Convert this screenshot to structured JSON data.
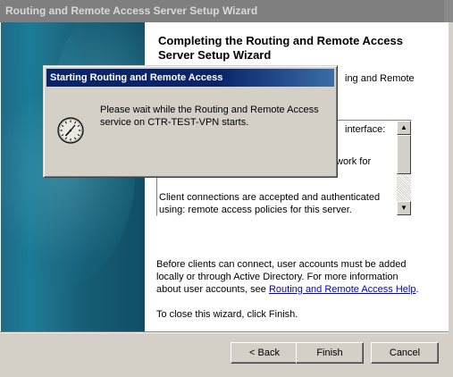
{
  "wizard": {
    "title": "Routing and Remote Access Server Setup Wizard",
    "heading": "Completing the Routing and Remote Access Server Setup Wizard",
    "intro_visible": "ing and Remote",
    "summary_lines": [
      "interface:",
      "work for",
      "Client connections are accepted and authenticated",
      "using: remote access policies for this server."
    ],
    "para1_text": "Before clients can connect, user accounts must be added locally or through Active Directory. For more information about user accounts, see ",
    "para1_link": "Routing and Remote Access Help",
    "para1_end": ".",
    "para2": "To close this wizard, click Finish.",
    "buttons": {
      "back": "< Back",
      "finish": "Finish",
      "cancel": "Cancel"
    },
    "scroll_up": "▲",
    "scroll_down": "▼"
  },
  "dialog": {
    "title": "Starting Routing and Remote Access",
    "message": "Please wait while the Routing and Remote Access service on CTR-TEST-VPN starts.",
    "icon": "clock-icon"
  },
  "colors": {
    "dialog_title_bg": "#0a246a",
    "window_title_bg": "#7f7f7f",
    "link": "#0000cc",
    "side_panel": "#1a7d97"
  }
}
